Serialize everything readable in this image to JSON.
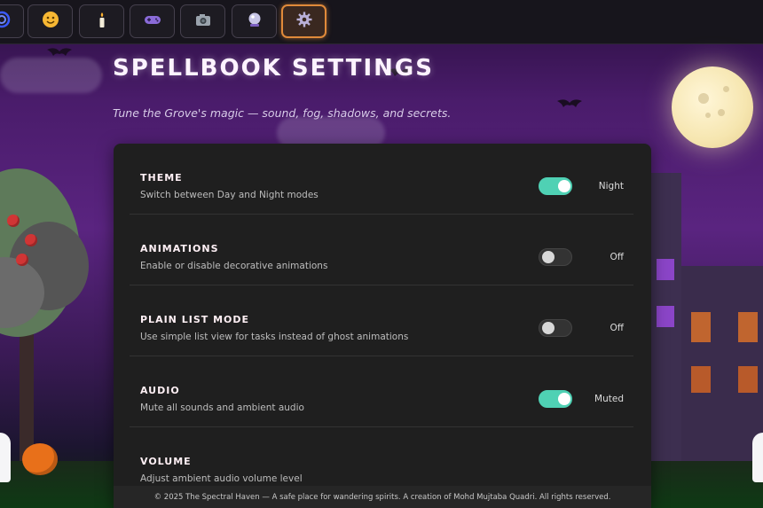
{
  "nav": {
    "tabs": [
      {
        "icon": "spiral-icon",
        "active": false
      },
      {
        "icon": "smiley-icon",
        "active": false
      },
      {
        "icon": "candle-icon",
        "active": false
      },
      {
        "icon": "gamepad-icon",
        "active": false
      },
      {
        "icon": "camera-icon",
        "active": false
      },
      {
        "icon": "crystal-ball-icon",
        "active": false
      },
      {
        "icon": "gear-icon",
        "active": true
      }
    ]
  },
  "header": {
    "title": "SPELLBOOK SETTINGS",
    "subtitle": "Tune the Grove's magic — sound, fog, shadows, and secrets."
  },
  "settings": [
    {
      "title": "THEME",
      "description": "Switch between Day and Night modes",
      "enabled": true,
      "state": "Night"
    },
    {
      "title": "ANIMATIONS",
      "description": "Enable or disable decorative animations",
      "enabled": false,
      "state": "Off"
    },
    {
      "title": "PLAIN LIST MODE",
      "description": "Use simple list view for tasks instead of ghost animations",
      "enabled": false,
      "state": "Off"
    },
    {
      "title": "AUDIO",
      "description": "Mute all sounds and ambient audio",
      "enabled": true,
      "state": "Muted"
    },
    {
      "title": "VOLUME",
      "description": "Adjust ambient audio volume level"
    }
  ],
  "footer": {
    "text": "© 2025 The Spectral Haven — A safe place for wandering spirits. A creation of Mohd Mujtaba Quadri. All rights reserved."
  },
  "colors": {
    "accent_toggle": "#4fd1b4",
    "active_tab_border": "#e08a3a",
    "panel_bg": "#1f1f1f"
  }
}
